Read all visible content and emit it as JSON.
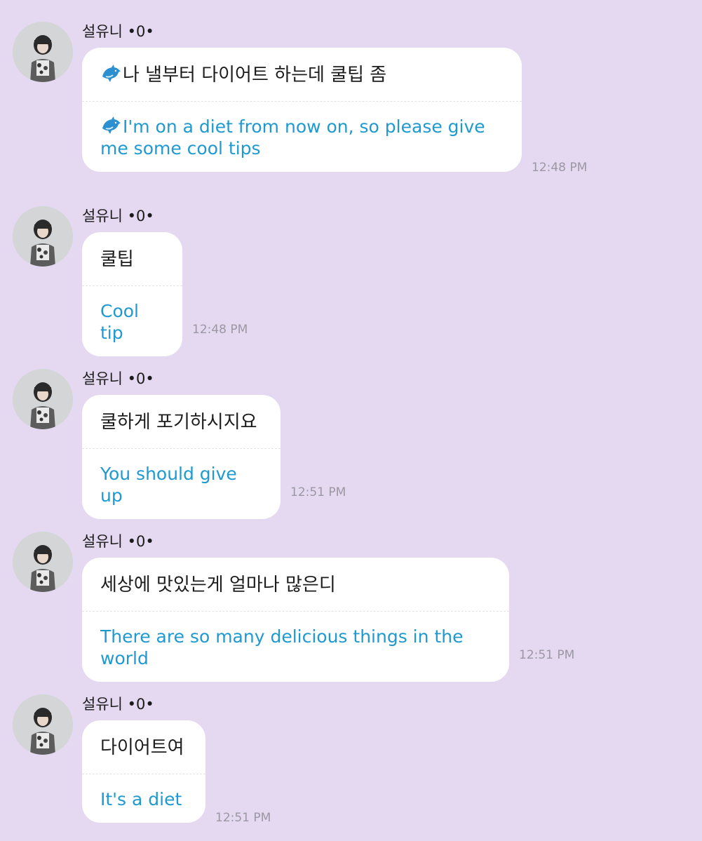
{
  "colors": {
    "background": "#e4d9f1",
    "bubble": "#ffffff",
    "translation_text": "#1f9ad1",
    "timestamp": "#9b97a3"
  },
  "messages": [
    {
      "sender": "설유니 •0•",
      "original": "나 낼부터 다이어트 하는데 쿨팁 좀",
      "translation": "I'm on a diet from now on, so please give me some cool tips",
      "time": "12:48 PM",
      "icon": "dolphin-icon"
    },
    {
      "sender": "설유니 •0•",
      "original": "쿨팁",
      "translation": "Cool tip",
      "time": "12:48 PM"
    },
    {
      "sender": "설유니 •0•",
      "original": "쿨하게 포기하시지요",
      "translation": "You should give up",
      "time": "12:51 PM"
    },
    {
      "sender": "설유니 •0•",
      "original": "세상에 맛있는게 얼마나 많은디",
      "translation": "There are so many delicious things in the world",
      "time": "12:51 PM"
    },
    {
      "sender": "설유니 •0•",
      "original": "다이어트여",
      "translation": "It's a diet",
      "time": "12:51 PM"
    }
  ]
}
